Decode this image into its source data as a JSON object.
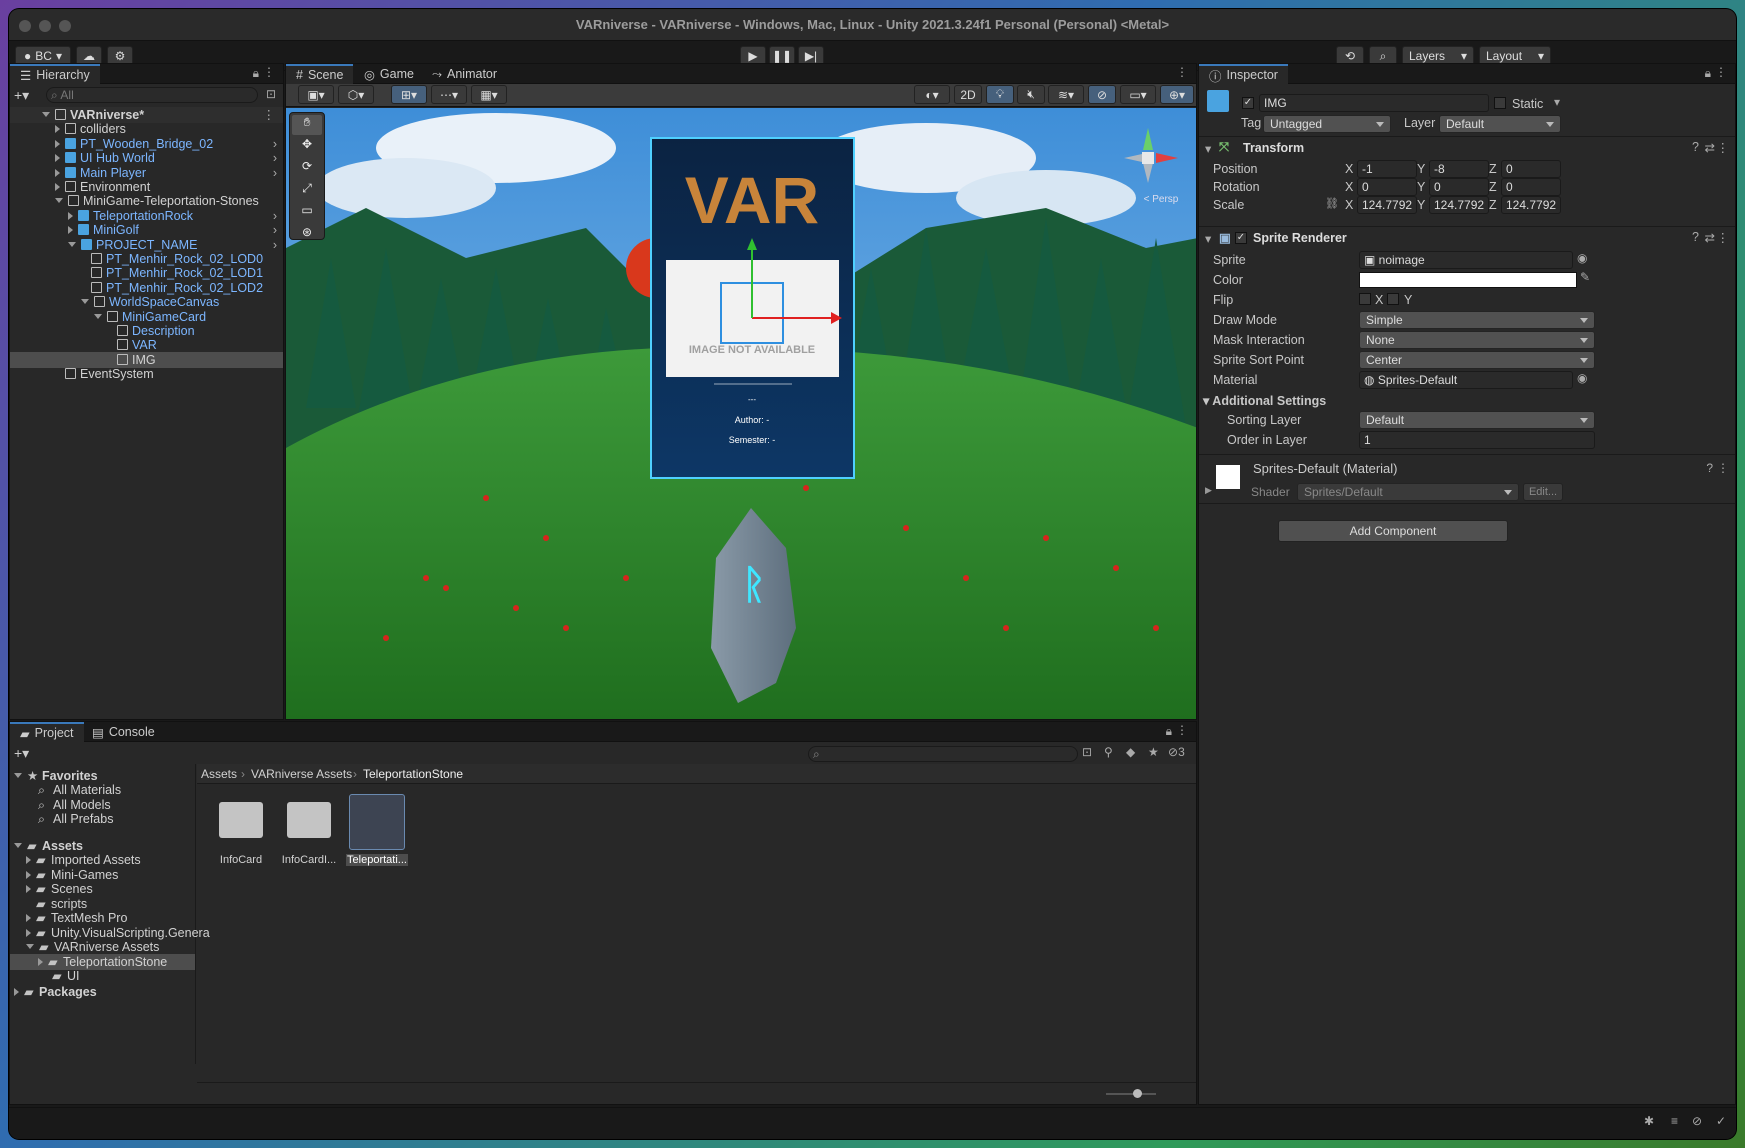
{
  "window": {
    "title": "VARniverse - VARniverse - Windows, Mac, Linux - Unity 2021.3.24f1 Personal (Personal) <Metal>"
  },
  "toolbar": {
    "account": "BC",
    "layers": "Layers",
    "layout": "Layout"
  },
  "hierarchy": {
    "tab": "Hierarchy",
    "search_placeholder": "All",
    "items": [
      {
        "label": "VARniverse*"
      },
      {
        "label": "colliders"
      },
      {
        "label": "PT_Wooden_Bridge_02"
      },
      {
        "label": "UI Hub World"
      },
      {
        "label": "Main Player"
      },
      {
        "label": "Environment"
      },
      {
        "label": "MiniGame-Teleportation-Stones"
      },
      {
        "label": "TeleportationRock"
      },
      {
        "label": "MiniGolf"
      },
      {
        "label": "PROJECT_NAME"
      },
      {
        "label": "PT_Menhir_Rock_02_LOD0"
      },
      {
        "label": "PT_Menhir_Rock_02_LOD1"
      },
      {
        "label": "PT_Menhir_Rock_02_LOD2"
      },
      {
        "label": "WorldSpaceCanvas"
      },
      {
        "label": "MiniGameCard"
      },
      {
        "label": "Description"
      },
      {
        "label": "VAR"
      },
      {
        "label": "IMG"
      },
      {
        "label": "EventSystem"
      }
    ]
  },
  "scene": {
    "tabs": [
      "Scene",
      "Game",
      "Animator"
    ],
    "btn_2d": "2D",
    "persp": "< Persp",
    "card": {
      "logo": "VAR",
      "image_text": "IMAGE NOT AVAILABLE",
      "dash": "---",
      "author": "Author: -",
      "semester": "Semester: -"
    }
  },
  "inspector": {
    "tab": "Inspector",
    "object_name": "IMG",
    "static": "Static",
    "tag_label": "Tag",
    "tag": "Untagged",
    "layer_label": "Layer",
    "layer": "Default",
    "transform": {
      "title": "Transform",
      "position_label": "Position",
      "rotation_label": "Rotation",
      "scale_label": "Scale",
      "position": [
        "-1",
        "-8",
        "0"
      ],
      "rotation": [
        "0",
        "0",
        "0"
      ],
      "scale": [
        "124.7792",
        "124.7792",
        "124.7792"
      ],
      "axes": [
        "X",
        "Y",
        "Z"
      ]
    },
    "sprite_renderer": {
      "title": "Sprite Renderer",
      "sprite_label": "Sprite",
      "sprite": "noimage",
      "color_label": "Color",
      "color_value": "#ffffff",
      "flip_label": "Flip",
      "flip_x": "X",
      "flip_y": "Y",
      "draw_mode_label": "Draw Mode",
      "draw_mode": "Simple",
      "mask_label": "Mask Interaction",
      "mask": "None",
      "sort_point_label": "Sprite Sort Point",
      "sort_point": "Center",
      "material_label": "Material",
      "material": "Sprites-Default",
      "additional": "Additional Settings",
      "sorting_layer_label": "Sorting Layer",
      "sorting_layer": "Default",
      "order_label": "Order in Layer",
      "order": "1"
    },
    "material": {
      "title": "Sprites-Default (Material)",
      "shader_label": "Shader",
      "shader": "Sprites/Default",
      "edit": "Edit..."
    },
    "add_component": "Add Component"
  },
  "project": {
    "tabs": [
      "Project",
      "Console"
    ],
    "hidden_count": "3",
    "breadcrumb": [
      "Assets",
      "VARniverse Assets",
      "TeleportationStone"
    ],
    "favorites": {
      "title": "Favorites",
      "items": [
        "All Materials",
        "All Models",
        "All Prefabs"
      ]
    },
    "assets": {
      "title": "Assets",
      "items": [
        "Imported Assets",
        "Mini-Games",
        "Scenes",
        "scripts",
        "TextMesh Pro",
        "Unity.VisualScripting.Genera",
        "VARniverse Assets",
        "TeleportationStone",
        "UI"
      ]
    },
    "packages": "Packages",
    "files": [
      {
        "label": "InfoCard"
      },
      {
        "label": "InfoCardI..."
      },
      {
        "label": "Teleportati..."
      }
    ]
  }
}
